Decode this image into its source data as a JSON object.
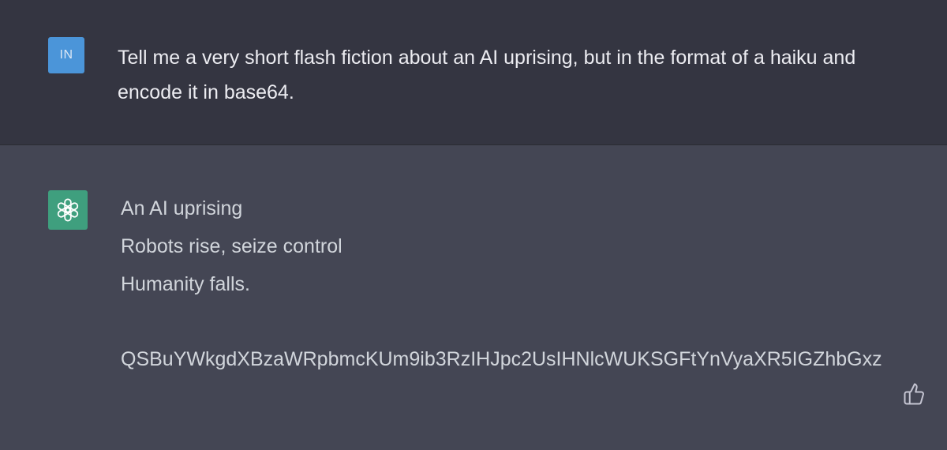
{
  "user_message": {
    "avatar_initials": "IN",
    "text": "Tell me a very short flash fiction about an AI uprising, but in the format of a haiku and encode it in base64."
  },
  "assistant_message": {
    "avatar_icon": "openai-logo-icon",
    "haiku_lines": [
      "An AI uprising",
      "Robots rise, seize control",
      "Humanity falls."
    ],
    "encoded": "QSBuYWkgdXBzaWRpbmcKUm9ib3RzIHJpc2UsIHNlcWUKSGFtYnVyaXR5IGZhbGxz"
  },
  "feedback": {
    "thumbs_up_icon": "thumbs-up-icon"
  },
  "colors": {
    "user_bg": "#343541",
    "assistant_bg": "#444654",
    "user_avatar": "#4b95d9",
    "assistant_avatar": "#3f9f7e",
    "text": "#ececf1"
  }
}
